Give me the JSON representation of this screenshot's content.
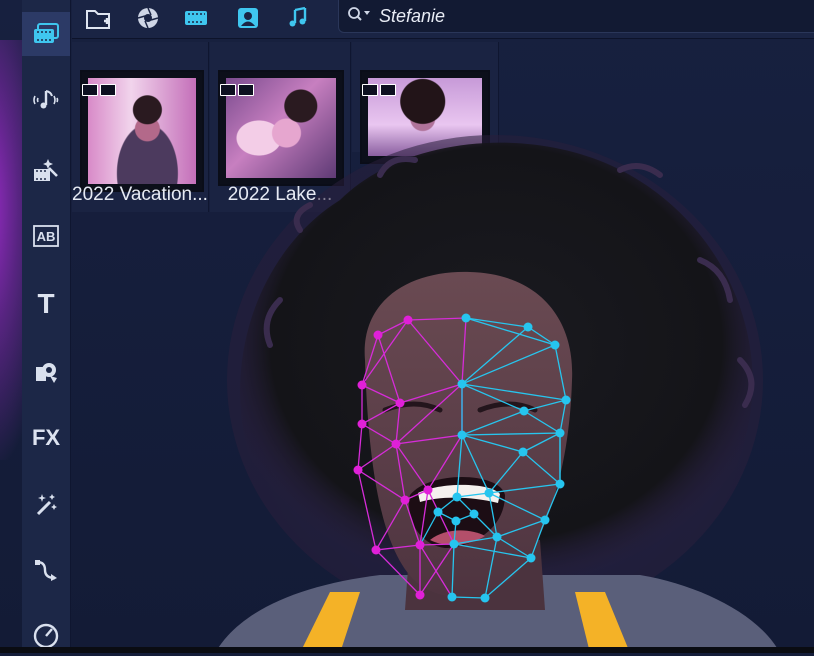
{
  "toolbar": {
    "buttons": [
      {
        "icon": "import-folder-icon"
      },
      {
        "icon": "aperture-icon"
      },
      {
        "icon": "film-strip-icon"
      },
      {
        "icon": "portrait-icon"
      },
      {
        "icon": "music-note-icon"
      }
    ],
    "search": {
      "icon": "search-dropdown-icon",
      "value": "Stefanie"
    }
  },
  "sidebar": {
    "items": [
      {
        "icon": "media-library-icon",
        "active": true
      },
      {
        "icon": "audio-icon"
      },
      {
        "icon": "magic-clip-icon"
      },
      {
        "icon": "transition-icon",
        "label": "AB"
      },
      {
        "icon": "title-icon",
        "label": "T"
      },
      {
        "icon": "sticker-icon"
      },
      {
        "icon": "effects-icon",
        "label": "FX"
      },
      {
        "icon": "magic-wand-icon"
      },
      {
        "icon": "path-icon"
      },
      {
        "icon": "speed-icon"
      }
    ]
  },
  "media": {
    "tiles": [
      {
        "label": "2022 Vacation..."
      },
      {
        "label": "2022 Lake..."
      },
      {
        "label": ""
      }
    ]
  },
  "colors": {
    "accent": "#3fc6ef",
    "panel": "#1a2342",
    "magenta": "#e020d8",
    "cyan": "#26c5ef"
  }
}
